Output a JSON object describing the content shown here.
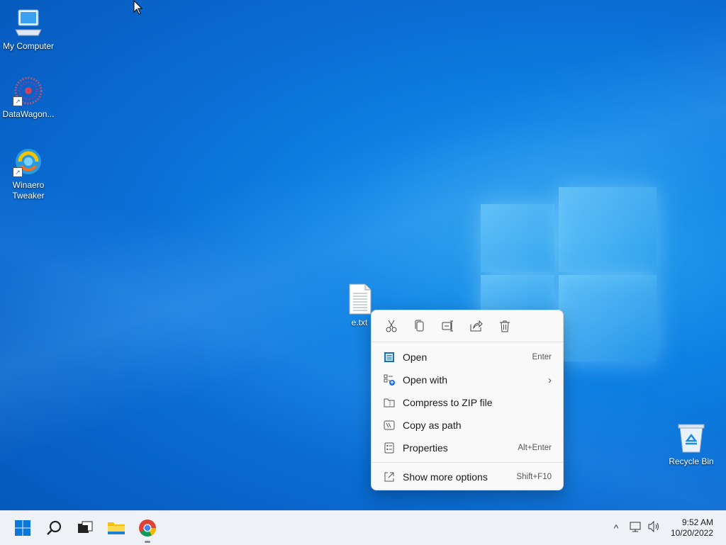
{
  "desktop": {
    "icons": [
      {
        "label": "My Computer"
      },
      {
        "label": "DataWagon..."
      },
      {
        "label": "Winaero Tweaker"
      },
      {
        "label": "e.txt"
      },
      {
        "label": "Recycle Bin"
      }
    ]
  },
  "context_menu": {
    "quick_actions": [
      {
        "icon": "cut-icon"
      },
      {
        "icon": "copy-icon"
      },
      {
        "icon": "rename-icon"
      },
      {
        "icon": "share-icon"
      },
      {
        "icon": "delete-icon"
      }
    ],
    "items": [
      {
        "label": "Open",
        "shortcut": "Enter",
        "icon": "open-icon"
      },
      {
        "label": "Open with",
        "shortcut": "",
        "icon": "open-with-icon",
        "submenu": true
      },
      {
        "label": "Compress to ZIP file",
        "shortcut": "",
        "icon": "zip-icon"
      },
      {
        "label": "Copy as path",
        "shortcut": "",
        "icon": "copy-path-icon"
      },
      {
        "label": "Properties",
        "shortcut": "Alt+Enter",
        "icon": "properties-icon"
      },
      {
        "label": "Show more options",
        "shortcut": "Shift+F10",
        "icon": "more-options-icon"
      }
    ]
  },
  "taskbar": {
    "apps": [
      "start-icon",
      "search-icon",
      "task-view-icon",
      "file-explorer-icon",
      "chrome-icon"
    ],
    "clock": {
      "time": "9:52 AM",
      "date": "10/20/2022"
    }
  },
  "colors": {
    "accent": "#0f82e4",
    "menu_bg": "#f9f9f9",
    "taskbar_bg": "#eef1f5"
  }
}
